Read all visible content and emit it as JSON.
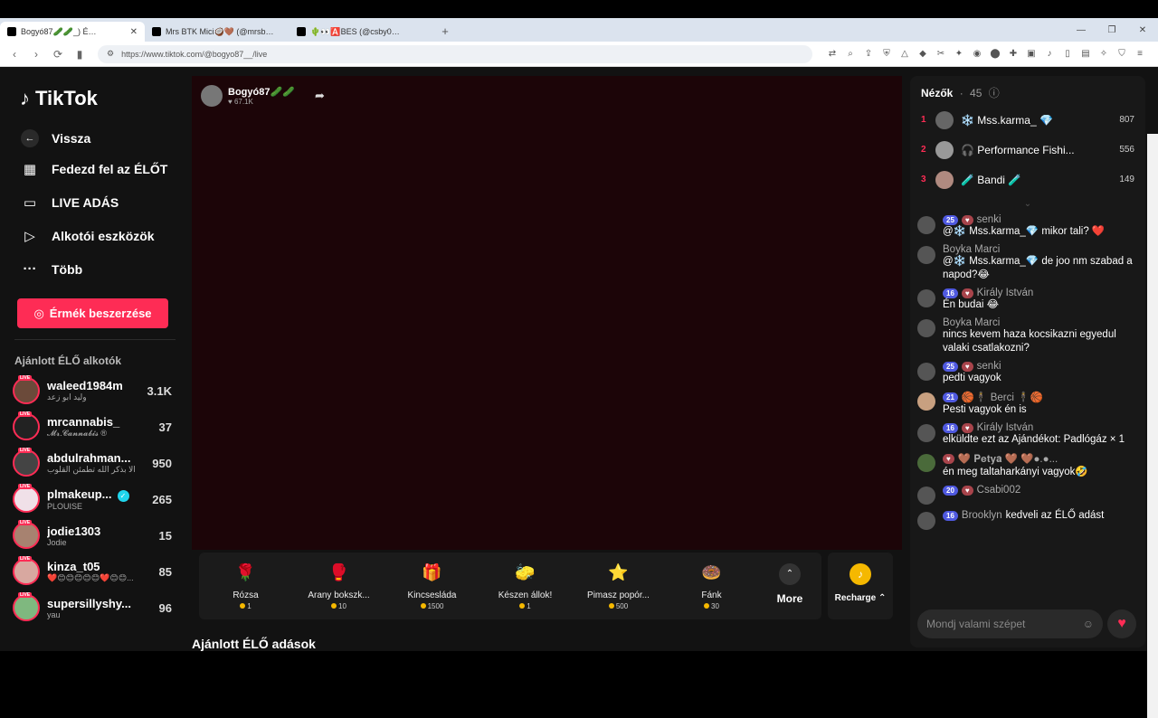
{
  "browser": {
    "tabs": [
      {
        "title": "Bogyó87🥒🥒_) É…",
        "active": true
      },
      {
        "title": "Mrs BTK Mici🥥🤎 (@mrsb…",
        "active": false
      },
      {
        "title": "🌵👀🅰️BES (@csby0…",
        "active": false
      }
    ],
    "url": "https://www.tiktok.com/@bogyo87__/live"
  },
  "sidebar": {
    "logo": "TikTok",
    "back": "Vissza",
    "nav": [
      {
        "label": "Fedezd fel az ÉLŐT",
        "icon": "calendar-icon"
      },
      {
        "label": "LIVE ADÁS",
        "icon": "camera-icon"
      },
      {
        "label": "Alkotói eszközök",
        "icon": "play-icon"
      },
      {
        "label": "Több",
        "icon": "more-icon"
      }
    ],
    "coins_button": "Érmék beszerzése",
    "section_title": "Ajánlott ÉLŐ alkotók",
    "creators": [
      {
        "name": "waleed1984m",
        "sub": "وليد ابو زعد",
        "count": "3.1K"
      },
      {
        "name": "mrcannabis_",
        "sub": "𝓜𝓻.𝓒𝓪𝓷𝓷𝓪𝓫𝓲𝓼 ®",
        "count": "37"
      },
      {
        "name": "abdulrahman...",
        "sub": "الا بذكر الله تطمئن القلوب",
        "count": "950"
      },
      {
        "name": "plmakeup...",
        "sub": "PLOUISE",
        "count": "265"
      },
      {
        "name": "jodie1303",
        "sub": "Jodie",
        "count": "15"
      },
      {
        "name": "kinza_t05",
        "sub": "❤️😊😊😊😊😊❤️😊😊...",
        "count": "85"
      },
      {
        "name": "supersillyshy...",
        "sub": "yau",
        "count": "96"
      }
    ]
  },
  "stage": {
    "host_name": "Bogyó87🥒🥒",
    "host_likes": "67.1K",
    "gifts": [
      {
        "name": "Rózsa",
        "price": "1",
        "icon": "🌹"
      },
      {
        "name": "Arany bokszk...",
        "price": "10",
        "icon": "🥊"
      },
      {
        "name": "Kincsesláda",
        "price": "1500",
        "icon": "🎁"
      },
      {
        "name": "Készen állok!",
        "price": "1",
        "icon": "🧽"
      },
      {
        "name": "Pimasz popór...",
        "price": "500",
        "icon": "⭐"
      },
      {
        "name": "Fánk",
        "price": "30",
        "icon": "🍩"
      }
    ],
    "more_label": "More",
    "recharge_label": "Recharge ⌃",
    "below_title": "Ajánlott ÉLŐ adások"
  },
  "viewers": {
    "title": "Nézők",
    "count": "45",
    "top": [
      {
        "rank": "1",
        "name": "❄️ Mss.karma_ 💎",
        "score": "807"
      },
      {
        "rank": "2",
        "name": "🎧 Performance Fishi...",
        "score": "556"
      },
      {
        "rank": "3",
        "name": "🧪 Bandi 🧪",
        "score": "149"
      }
    ]
  },
  "chat": [
    {
      "badge": "25",
      "user": "senki",
      "text": "@❄️ Mss.karma_💎 mikor tali? ❤️"
    },
    {
      "badge": "",
      "user": "Boyka Marci",
      "text": "@❄️ Mss.karma_💎 de joo nm szabad a napod?😂"
    },
    {
      "badge": "16",
      "user": "Király István",
      "text": "Én budai 😂"
    },
    {
      "badge": "",
      "user": "Boyka Marci",
      "text": "nincs kevem haza kocsikazni egyedul valaki csatlakozni?"
    },
    {
      "badge": "25",
      "user": "senki",
      "text": "pedti vagyok"
    },
    {
      "badge": "21",
      "user": "🏀🕴 Berci 🕴🏀",
      "text": "Pesti vagyok én is"
    },
    {
      "badge": "16",
      "user": "Király István",
      "text": "elküldte ezt az Ajándékot: Padlógáz × 1"
    },
    {
      "badge": "",
      "user": "🤎 𝐏𝐞𝐭𝐲𝐚 🤎 🤎●.●...",
      "text": "én meg taltaharkányi vagyok🤣"
    },
    {
      "badge": "20",
      "user": "Csabi002",
      "text": ""
    },
    {
      "badge": "16",
      "user": "Brooklyn",
      "text": "kedveli az ÉLŐ adást"
    }
  ],
  "chat_input_placeholder": "Mondj valami szépet"
}
